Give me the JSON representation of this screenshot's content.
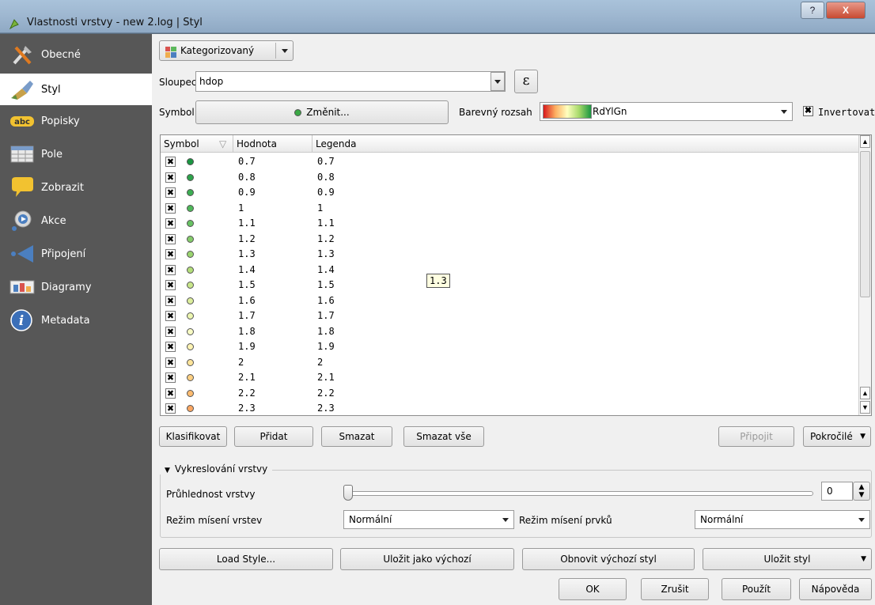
{
  "window": {
    "title": "Vlastnosti vrstvy - new  2.log | Styl",
    "help_label": "?",
    "close_label": "X"
  },
  "sidebar": {
    "items": [
      {
        "label": "Obecné",
        "icon": "tools-icon"
      },
      {
        "label": "Styl",
        "icon": "paintbrush-icon"
      },
      {
        "label": "Popisky",
        "icon": "abc-label-icon"
      },
      {
        "label": "Pole",
        "icon": "table-fields-icon"
      },
      {
        "label": "Zobrazit",
        "icon": "speech-bubble-icon"
      },
      {
        "label": "Akce",
        "icon": "gear-action-icon"
      },
      {
        "label": "Připojení",
        "icon": "join-arrow-icon"
      },
      {
        "label": "Diagramy",
        "icon": "chart-icon"
      },
      {
        "label": "Metadata",
        "icon": "info-icon"
      }
    ],
    "active_index": 1
  },
  "renderer": {
    "type_label": "Kategorizovaný",
    "column_label": "Sloupec",
    "column_value": "hdop",
    "expression_label": "ε",
    "symbol_label": "Symbol",
    "change_label": "Změnit...",
    "color_ramp_label": "Barevný rozsah",
    "color_ramp_value": "RdYlGn",
    "invert_label": "Invertovat",
    "invert_checked": true
  },
  "table": {
    "headers": [
      "Symbol",
      "Hodnota",
      "Legenda"
    ],
    "tooltip": "1.3",
    "rows": [
      {
        "value": "0.7",
        "legend": "0.7",
        "color": "#1a9641"
      },
      {
        "value": "0.8",
        "legend": "0.8",
        "color": "#2da34b"
      },
      {
        "value": "0.9",
        "legend": "0.9",
        "color": "#3cae52"
      },
      {
        "value": "1",
        "legend": "1",
        "color": "#4fb85a"
      },
      {
        "value": "1.1",
        "legend": "1.1",
        "color": "#68c263"
      },
      {
        "value": "1.2",
        "legend": "1.2",
        "color": "#85cc6b"
      },
      {
        "value": "1.3",
        "legend": "1.3",
        "color": "#9ad46f"
      },
      {
        "value": "1.4",
        "legend": "1.4",
        "color": "#b3de7a"
      },
      {
        "value": "1.5",
        "legend": "1.5",
        "color": "#c8e68a"
      },
      {
        "value": "1.6",
        "legend": "1.6",
        "color": "#dcee9c"
      },
      {
        "value": "1.7",
        "legend": "1.7",
        "color": "#ecf6b0"
      },
      {
        "value": "1.8",
        "legend": "1.8",
        "color": "#f8fbc4"
      },
      {
        "value": "1.9",
        "legend": "1.9",
        "color": "#fff4b3"
      },
      {
        "value": "2",
        "legend": "2",
        "color": "#fee49a"
      },
      {
        "value": "2.1",
        "legend": "2.1",
        "color": "#fed082"
      },
      {
        "value": "2.2",
        "legend": "2.2",
        "color": "#fdbb6f"
      },
      {
        "value": "2.3",
        "legend": "2.3",
        "color": "#fca762"
      }
    ]
  },
  "actions": {
    "classify": "Klasifikovat",
    "add": "Přidat",
    "delete": "Smazat",
    "delete_all": "Smazat vše",
    "join": "Připojit",
    "advanced": "Pokročilé"
  },
  "layer_rendering": {
    "title": "Vykreslování vrstvy",
    "transparency_label": "Průhlednost vrstvy",
    "transparency_value": "0",
    "layer_blend_label": "Režim mísení vrstev",
    "layer_blend_value": "Normální",
    "feature_blend_label": "Režim mísení prvků",
    "feature_blend_value": "Normální"
  },
  "style_buttons": {
    "load": "Load Style...",
    "save_default": "Uložit jako výchozí",
    "restore_default": "Obnovit výchozí styl",
    "save_style": "Uložit styl"
  },
  "dialog_buttons": {
    "ok": "OK",
    "cancel": "Zrušit",
    "apply": "Použít",
    "help": "Nápověda"
  }
}
